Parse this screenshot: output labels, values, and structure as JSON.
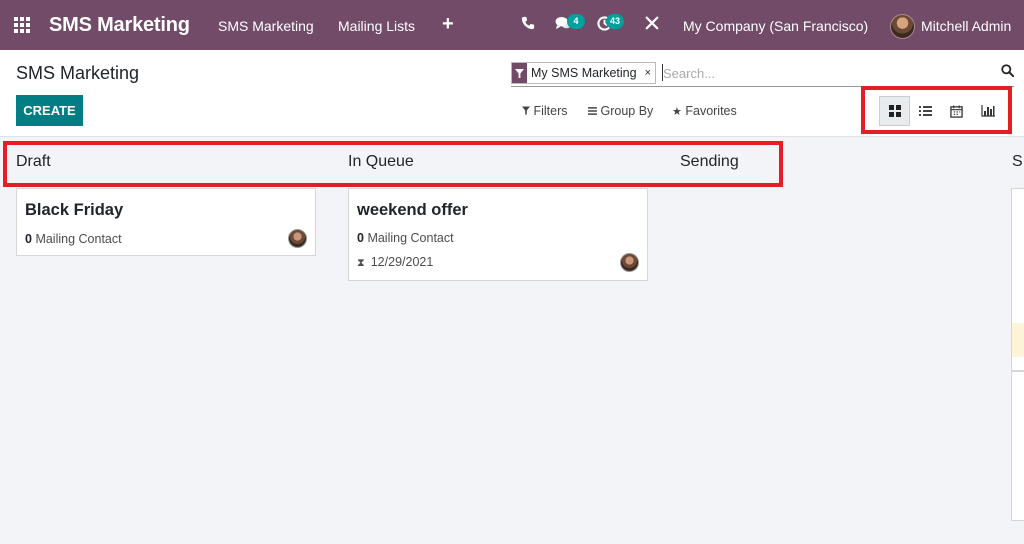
{
  "navbar": {
    "brand": "SMS Marketing",
    "menu": [
      "SMS Marketing",
      "Mailing Lists"
    ],
    "plus": "+",
    "messages_badge": "4",
    "activities_badge": "43",
    "company": "My Company (San Francisco)",
    "user": "Mitchell Admin"
  },
  "control": {
    "title": "SMS Marketing",
    "create_label": "CREATE",
    "facet_label": "My SMS Marketing",
    "facet_remove": "×",
    "search_placeholder": "Search...",
    "filters_label": "Filters",
    "groupby_label": "Group By",
    "favorites_label": "Favorites"
  },
  "views": [
    "kanban",
    "list",
    "calendar",
    "graph"
  ],
  "active_view": "kanban",
  "columns": [
    {
      "title": "Draft",
      "cards": [
        {
          "title": "Black Friday",
          "count": "0",
          "count_label": "Mailing Contact"
        }
      ]
    },
    {
      "title": "In Queue",
      "cards": [
        {
          "title": "weekend offer",
          "count": "0",
          "count_label": "Mailing Contact",
          "date": "12/29/2021"
        }
      ]
    },
    {
      "title": "Sending",
      "cards": []
    },
    {
      "title": "S",
      "cards": []
    }
  ],
  "colors": {
    "navbar": "#714b67",
    "create": "#017e84",
    "badge": "#00a09d",
    "highlight": "#e31e24"
  }
}
